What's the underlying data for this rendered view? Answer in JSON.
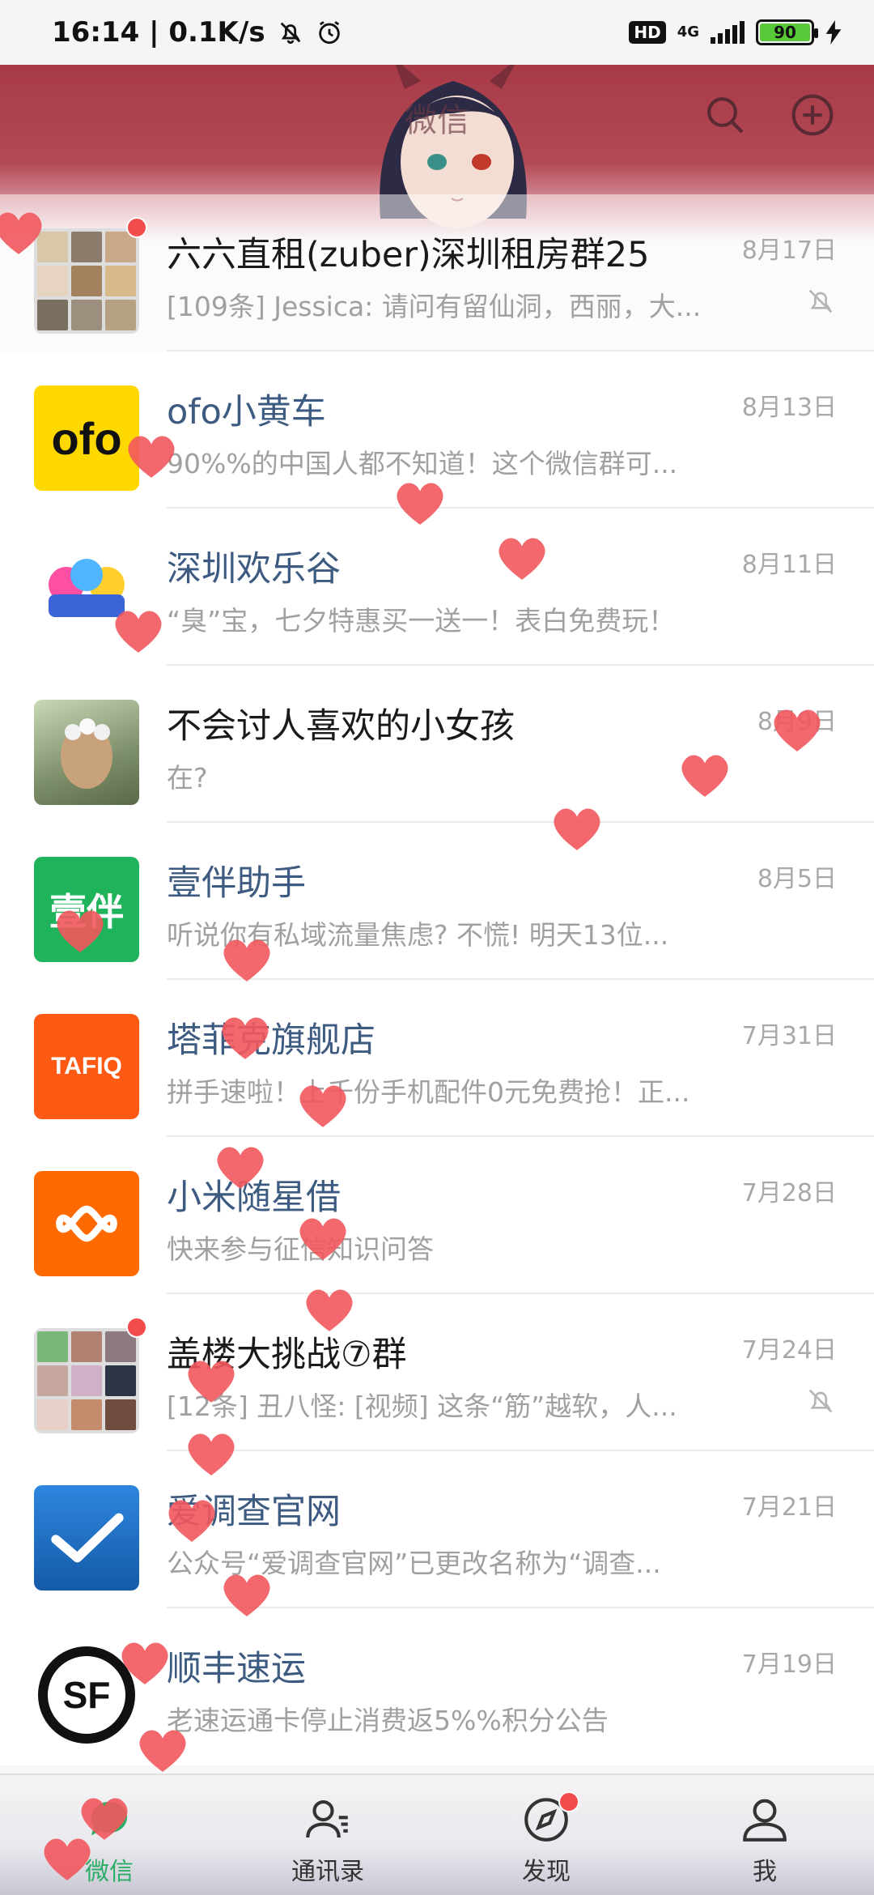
{
  "status_bar": {
    "time_speed": "16:14 | 0.1K/s",
    "hd": "HD",
    "network": "4G",
    "battery": "90"
  },
  "header": {
    "title": "微信",
    "search_icon": "search-icon",
    "add_icon": "plus-circle-icon"
  },
  "chats": [
    {
      "name": "六六直租(zuber)深圳租房群25",
      "preview": "[109条] Jessica: 请问有留仙洞，西丽，大...",
      "date": "8月17日",
      "muted": true,
      "unread_dot": true
    },
    {
      "name": "ofo小黄车",
      "preview": "90%%的中国人都不知道！这个微信群可...",
      "date": "8月13日",
      "muted": false,
      "unread_dot": false
    },
    {
      "name": "深圳欢乐谷",
      "preview": "“臭”宝，七夕特惠买一送一！表白免费玩！",
      "date": "8月11日",
      "muted": false,
      "unread_dot": false
    },
    {
      "name": "不会讨人喜欢的小女孩",
      "preview": "在?",
      "date": "8月9日",
      "muted": false,
      "unread_dot": false
    },
    {
      "name": "壹伴助手",
      "preview": "听说你有私域流量焦虑? 不慌! 明天13位...",
      "date": "8月5日",
      "muted": false,
      "unread_dot": false
    },
    {
      "name": "塔菲克旗舰店",
      "preview": "拼手速啦！上千份手机配件0元免费抢！正...",
      "date": "7月31日",
      "muted": false,
      "unread_dot": false
    },
    {
      "name": "小米随星借",
      "preview": "快来参与征信知识问答",
      "date": "7月28日",
      "muted": false,
      "unread_dot": false
    },
    {
      "name": "盖楼大挑战⑦群",
      "preview": "[12条] 丑八怪: [视频] 这条“筋”越软，人...",
      "date": "7月24日",
      "muted": true,
      "unread_dot": true
    },
    {
      "name": "爱调查官网",
      "preview": "公众号“爱调查官网”已更改名称为“调查...",
      "date": "7月21日",
      "muted": false,
      "unread_dot": false
    },
    {
      "name": "顺丰速运",
      "preview": "老速运通卡停止消费返5%%积分公告",
      "date": "7月19日",
      "muted": false,
      "unread_dot": false
    }
  ],
  "avatars": {
    "ofo": "ofo",
    "yiban": "壹伴",
    "tafiq": "TAFIQ",
    "sf": "SF"
  },
  "tabs": [
    {
      "label": "微信",
      "icon": "chat-bubble-icon"
    },
    {
      "label": "通讯录",
      "icon": "contacts-icon"
    },
    {
      "label": "发现",
      "icon": "compass-icon"
    },
    {
      "label": "我",
      "icon": "person-icon"
    }
  ],
  "colors": {
    "banner": "#a83a48",
    "ofo_yellow": "#ffd800",
    "yiban_green": "#1fb35c",
    "tafiq_orange": "#ff5a14",
    "xiaomi_orange": "#ff6a00",
    "survey_blue": "#1a73c9",
    "heart": "#f2585e",
    "active_tab": "#2aae67"
  }
}
